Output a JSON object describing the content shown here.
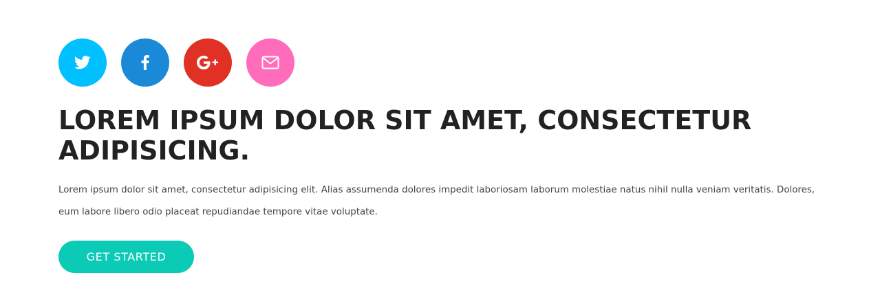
{
  "social": {
    "buttons": [
      {
        "name": "twitter",
        "icon": "twitter-icon",
        "color": "#00c0ff"
      },
      {
        "name": "facebook",
        "icon": "facebook-icon",
        "color": "#1a8ad8"
      },
      {
        "name": "google-plus",
        "icon": "google-plus-icon",
        "color": "#e03124"
      },
      {
        "name": "email",
        "icon": "envelope-icon",
        "color": "#ff6cbb"
      }
    ]
  },
  "hero": {
    "title": "LOREM IPSUM DOLOR SIT AMET, CONSECTETUR ADIPISICING.",
    "body": "Lorem ipsum dolor sit amet, consectetur adipisicing elit. Alias assumenda dolores impedit laboriosam laborum molestiae natus nihil nulla veniam veritatis. Dolores, eum labore libero odio placeat repudiandae tempore vitae voluptate.",
    "cta_label": "GET STARTED",
    "cta_color": "#0ccbb6"
  }
}
